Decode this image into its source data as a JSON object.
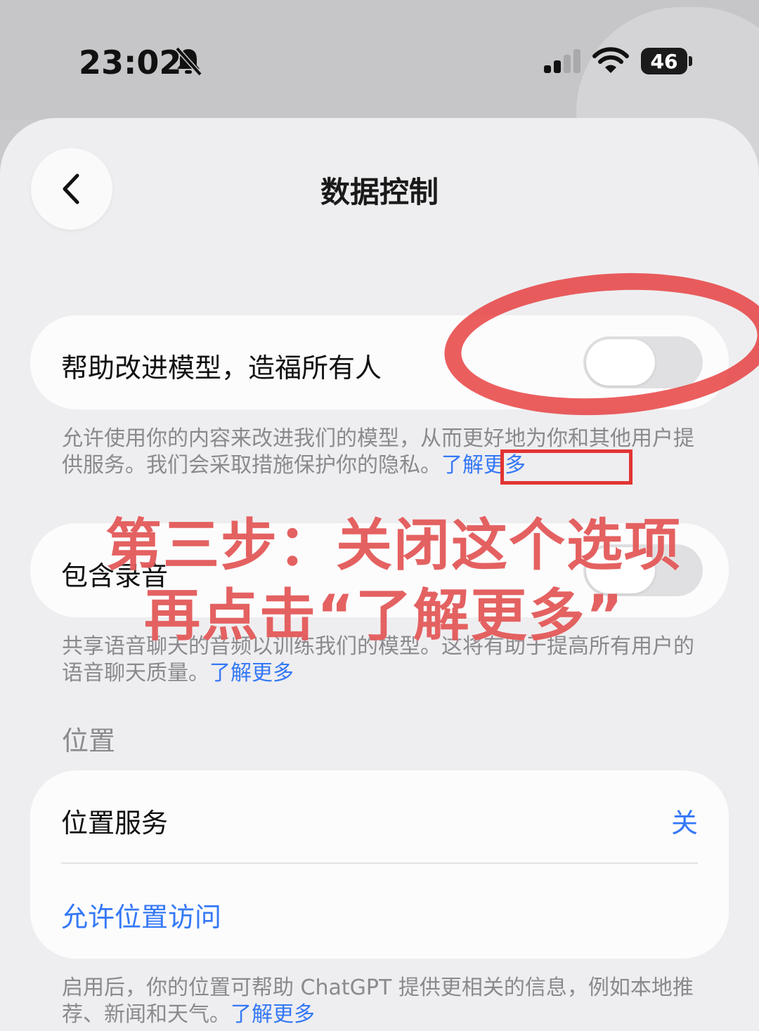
{
  "status": {
    "time": "23:02",
    "battery": "46",
    "icons": [
      "bell-muted-icon",
      "cellular-signal-icon",
      "wifi-icon",
      "battery-icon"
    ]
  },
  "header": {
    "title": "数据控制",
    "back_icon": "chevron-left-icon"
  },
  "settings": {
    "improve_model": {
      "label": "帮助改进模型，造福所有人",
      "enabled": false,
      "description": "允许使用你的内容来改进我们的模型，从而更好地为你和其他用户提供服务。我们会采取措施保护你的隐私。",
      "link": "了解更多"
    },
    "include_audio": {
      "label": "包含录音",
      "enabled": false,
      "description": "共享语音聊天的音频以训练我们的模型。这将有助于提高所有用户的语音聊天质量。",
      "link": "了解更多"
    },
    "location": {
      "section_title": "位置",
      "service_label": "位置服务",
      "service_value": "关",
      "allow_access": "允许位置访问",
      "description": "启用后，你的位置可帮助 ChatGPT 提供更相关的信息，例如本地推荐、新闻和天气。",
      "link": "了解更多"
    }
  },
  "annotation": {
    "line1": "第三步：关闭这个选项",
    "line2": "再点击“了解更多”",
    "color": "#e23434"
  },
  "colors": {
    "accent": "#3478f6",
    "background": "#eeeef0",
    "card": "#fcfcfd"
  }
}
